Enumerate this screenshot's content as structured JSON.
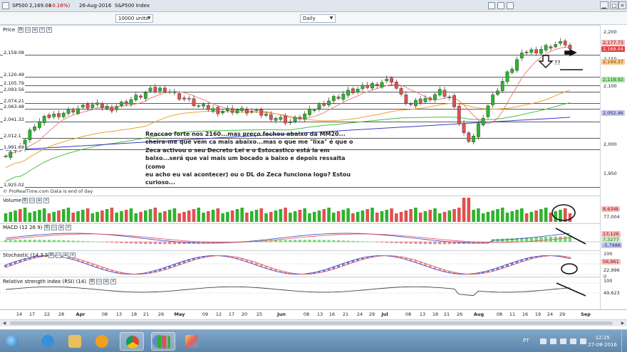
{
  "window": {
    "symbol": "SP500",
    "last_price": "2,169.04",
    "change": "(-0.16%)",
    "date": "26-Aug-2016",
    "instrument_name": "S&P500 Index"
  },
  "toolbar": {
    "units_value": "10000 units",
    "period_value": "Daily"
  },
  "panels": {
    "price": {
      "label": "Price"
    },
    "volume": {
      "label": "Volume"
    },
    "macd": {
      "label": "MACD (12 26 9)"
    },
    "stochastic": {
      "label": "Stochastic (14 3 5)"
    },
    "rsi": {
      "label": "Relative strength index (RSI) (14)"
    }
  },
  "credit": "© ProRealTime.com  Data is end of day",
  "annotation": "Reaccao forte nos 2160...mas preço fechou abaixo da MM20...\ncheira-me que vem ca mais abaixo...mas o que me \"lixa\" é que o\nZeca activou o seu Decreto Lei e o Estocastico está la em\nbaixo...será que vai mais um bocado a baixo e depois ressalta (como\neu acho eu vai acontecer) ou o DL do Zeca funciona logo? Estou\ncurioso...",
  "question_marks": "??",
  "horizontal_levels": [
    "2,159.08",
    "2,120.49",
    "2,105.79",
    "2,093.56",
    "2,074.21",
    "2,063.48",
    "2,041.32",
    "2,012.1",
    "1,991.69",
    "1,925.02"
  ],
  "price_axis": [
    "2,200",
    "2,150",
    "2,100",
    "2,050",
    "2,000",
    "1,950"
  ],
  "price_boxes": {
    "high": "2,177.73",
    "last": "2,169.04",
    "ma_orange": "2,144.37",
    "ma_green": "2,118.92",
    "ma_blue": "2,052.46"
  },
  "volume_axis": {
    "box": "8,634k",
    "value": "77,004"
  },
  "macd_axis": {
    "top": "13,126",
    "mid": "7,3277",
    "bottom": "-5,7986"
  },
  "stoch_axis": {
    "top": "100",
    "box": "56,961",
    "mid": "50",
    "value": "22,996",
    "bottom": "0"
  },
  "rsi_axis": {
    "top": "100",
    "value": "49,623"
  },
  "x_axis": [
    {
      "label": "14",
      "month": false
    },
    {
      "label": "17",
      "month": false
    },
    {
      "label": "22",
      "month": false
    },
    {
      "label": "28",
      "month": false
    },
    {
      "label": "Apr",
      "month": true
    },
    {
      "label": "08",
      "month": false
    },
    {
      "label": "13",
      "month": false
    },
    {
      "label": "18",
      "month": false
    },
    {
      "label": "21",
      "month": false
    },
    {
      "label": "26",
      "month": false
    },
    {
      "label": "May",
      "month": true
    },
    {
      "label": "09",
      "month": false
    },
    {
      "label": "12",
      "month": false
    },
    {
      "label": "17",
      "month": false
    },
    {
      "label": "20",
      "month": false
    },
    {
      "label": "25",
      "month": false
    },
    {
      "label": "Jun",
      "month": true
    },
    {
      "label": "08",
      "month": false
    },
    {
      "label": "13",
      "month": false
    },
    {
      "label": "16",
      "month": false
    },
    {
      "label": "21",
      "month": false
    },
    {
      "label": "24",
      "month": false
    },
    {
      "label": "29",
      "month": false
    },
    {
      "label": "Jul",
      "month": true
    },
    {
      "label": "08",
      "month": false
    },
    {
      "label": "13",
      "month": false
    },
    {
      "label": "18",
      "month": false
    },
    {
      "label": "21",
      "month": false
    },
    {
      "label": "26",
      "month": false
    },
    {
      "label": "Aug",
      "month": true
    },
    {
      "label": "08",
      "month": false
    },
    {
      "label": "11",
      "month": false
    },
    {
      "label": "16",
      "month": false
    },
    {
      "label": "19",
      "month": false
    },
    {
      "label": "24",
      "month": false
    },
    {
      "label": "29",
      "month": false
    },
    {
      "label": "Sep",
      "month": true
    }
  ],
  "taskbar": {
    "language": "PT",
    "time": "12:25",
    "date": "27-08-2016",
    "apps": [
      "start",
      "ie",
      "explorer",
      "media",
      "chrome",
      "orb",
      "prorealtime",
      "paint"
    ]
  },
  "colors": {
    "bull": "#2db32d",
    "bear": "#e05050",
    "ma_red": "#e8847a",
    "ma_orange": "#f0a030",
    "ma_green": "#40c040",
    "ma_blue": "#3a3ac8",
    "level_line": "#222222"
  }
}
